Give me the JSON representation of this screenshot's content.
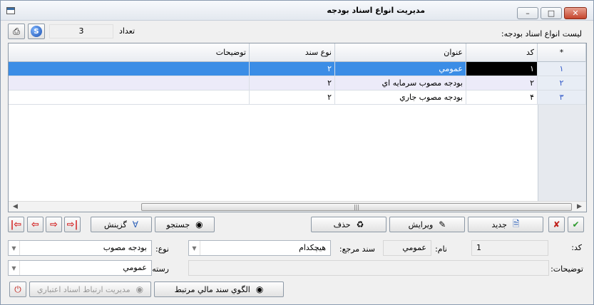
{
  "window": {
    "title": "مديريت انواع اسناد بودجه"
  },
  "toolbar": {
    "count_value": "3",
    "count_label": "تعداد",
    "list_label": "ليست انواع اسناد بودجه:"
  },
  "grid": {
    "columns": [
      "*",
      "کد",
      "عنوان",
      "نوع سند",
      "توضيحات"
    ],
    "rows": [
      {
        "num": "١",
        "code": "١",
        "title": "عمومي",
        "type": "٢",
        "desc": ""
      },
      {
        "num": "٢",
        "code": "٢",
        "title": "بودجه مصوب سرمايه اي",
        "type": "٢",
        "desc": ""
      },
      {
        "num": "٣",
        "code": "۴",
        "title": "بودجه مصوب جاري",
        "type": "٢",
        "desc": ""
      }
    ]
  },
  "actions": {
    "new_label": "جديد",
    "edit_label": "ويرايش",
    "delete_label": "حذف",
    "search_label": "جستجو",
    "filter_label": "گزينش"
  },
  "form": {
    "code_label": "کد:",
    "code_value": "1",
    "name_label": "نام:",
    "name_value": "عمومي",
    "ref_doc_label": "سند مرجع:",
    "ref_doc_value": "هيچکدام",
    "type_label": "نوع:",
    "type_value": "بودجه مصوب",
    "desc_label": "توضيحات:",
    "desc_value": "",
    "category_label": "رسته:",
    "category_value": "عمومي",
    "pattern_button": "الگوي سند مالي مرتبط",
    "credit_button": "مديريت ارتباط اسناد اعتباري"
  }
}
